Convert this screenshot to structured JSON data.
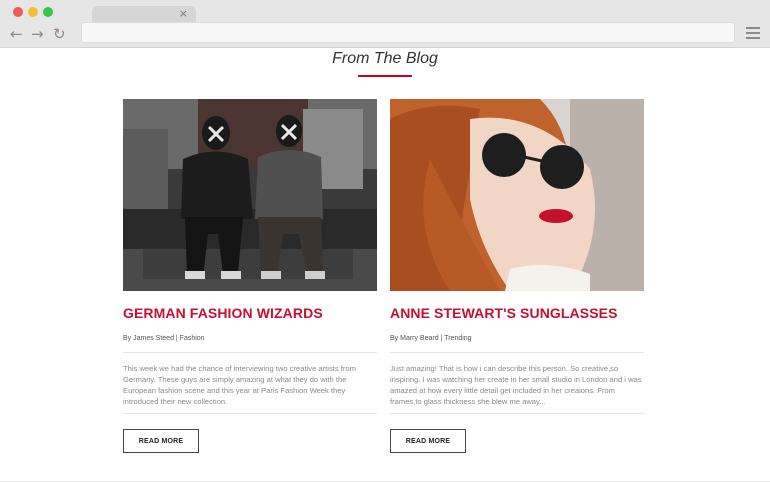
{
  "browser": {
    "tab_close": "×",
    "back_icon": "arrow-left-icon",
    "forward_icon": "arrow-right-icon",
    "reload_icon": "reload-icon",
    "menu_icon": "hamburger-menu-icon"
  },
  "section": {
    "title": "From The Blog",
    "accent_color": "#d0021b"
  },
  "posts": [
    {
      "title": "GERMAN FASHION WIZARDS",
      "byline": "By James Steed | Fashion",
      "excerpt": "This week we had the chance of interviewing two creative artists from Germany. These guys are simply amazing at what they do with the European fashion scene and this year at Paris Fashion Week they introduced their new collection.",
      "button": "READ MORE"
    },
    {
      "title": "ANNE STEWART'S SUNGLASSES",
      "byline": "By Marry Beard | Trending",
      "excerpt": "Just amazing! That is how i can describe this person. So creative,so inspiring. I was watching her create in her small studio in London and i was amazed at how every little detail get included in her creaions. From frames,to glass thickness she blew me away...",
      "button": "READ MORE"
    }
  ]
}
